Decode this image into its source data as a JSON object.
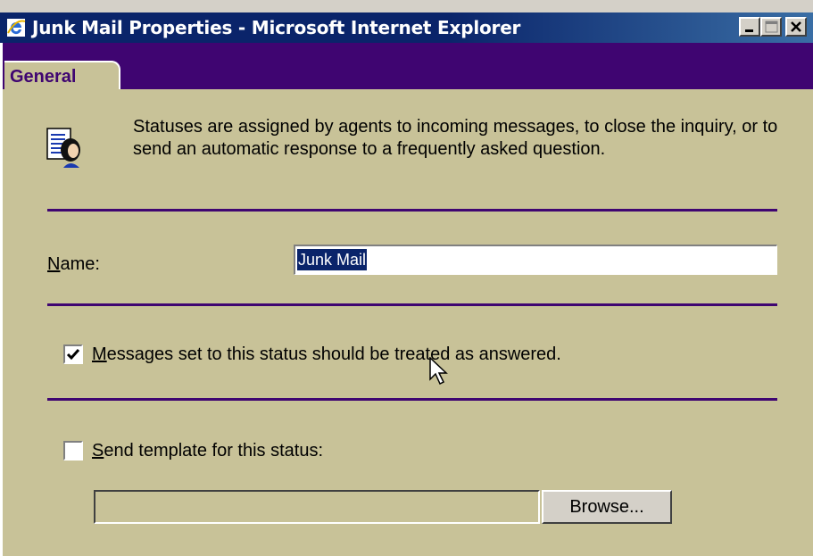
{
  "window": {
    "title": "Junk Mail Properties - Microsoft Internet Explorer",
    "title_bar_color": "#0a246a",
    "controls": [
      "minimize-icon",
      "maximize-icon",
      "close-icon"
    ]
  },
  "tabs": [
    {
      "label": "General",
      "selected": true
    }
  ],
  "colors": {
    "accent": "#3f0571",
    "panel": "#c8c298"
  },
  "description": "Statuses are assigned by agents to incoming messages, to close the inquiry, or to send an automatic response to a frequently asked question.",
  "name_field": {
    "label_accesskey": "N",
    "label_rest": "ame:",
    "value": "Junk Mail"
  },
  "answered_checkbox": {
    "checked": true,
    "label_accesskey": "M",
    "label_rest": "essages set to this status should be treated as answered."
  },
  "template_checkbox": {
    "checked": false,
    "label_accesskey": "S",
    "label_rest": "end template for this status:"
  },
  "template_path": {
    "value": ""
  },
  "browse_button": {
    "label": "Browse..."
  }
}
